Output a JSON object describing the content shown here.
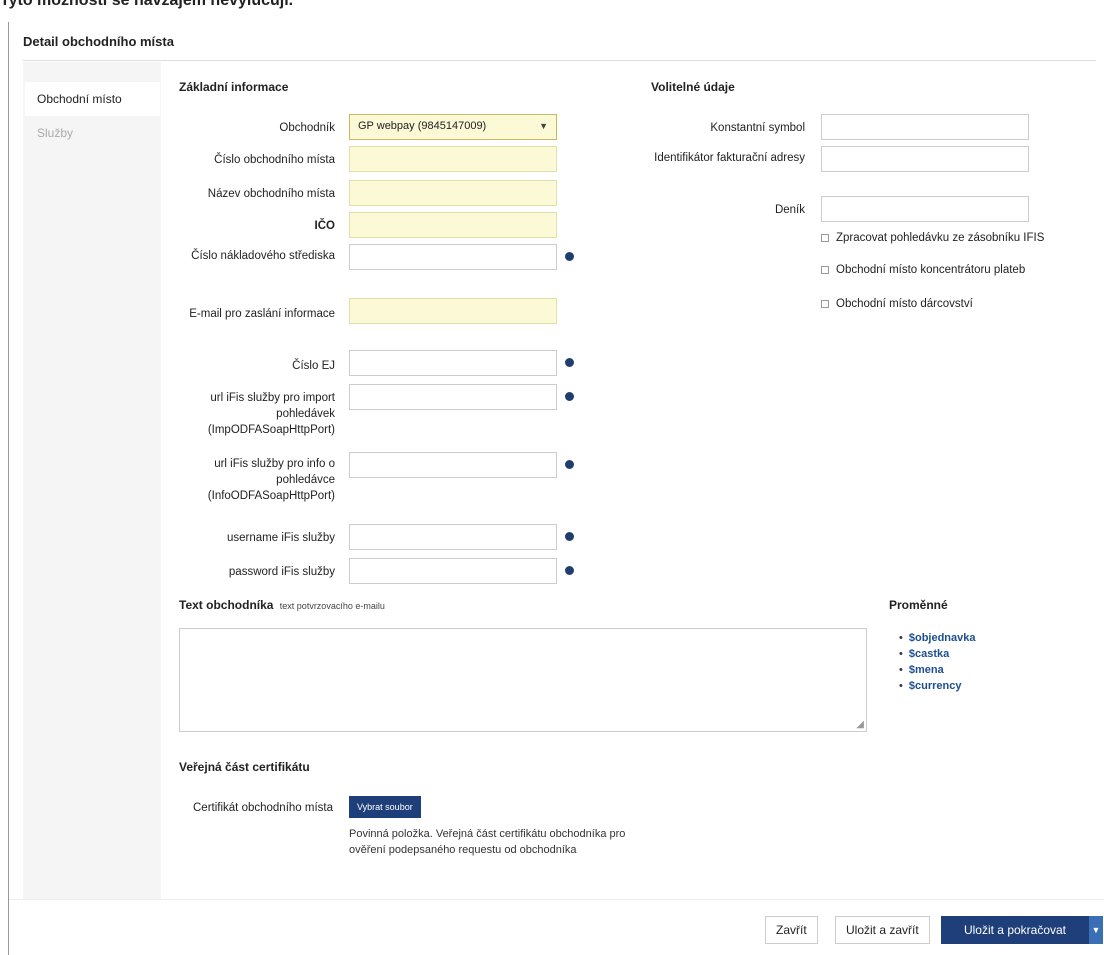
{
  "caption": "Tyto možnosti se navzájem nevylučují.",
  "dialog": {
    "title": "Detail obchodního místa"
  },
  "sidebar": {
    "items": [
      {
        "label": "Obchodní místo",
        "active": true
      },
      {
        "label": "Služby",
        "active": false
      }
    ]
  },
  "basic": {
    "title": "Základní informace",
    "merchant_label": "Obchodník",
    "merchant_value": "GP webpay (9845147009)",
    "fields": [
      {
        "label": "Číslo obchodního místa",
        "value": ""
      },
      {
        "label": "Název obchodního místa",
        "value": ""
      },
      {
        "label": "IČO",
        "value": ""
      },
      {
        "label": "Číslo nákladového střediska",
        "value": ""
      },
      {
        "label": "E-mail pro zaslání informace",
        "value": ""
      },
      {
        "label": "Číslo EJ",
        "value": ""
      },
      {
        "label": "url iFis služby pro import pohledávek (ImpODFASoapHttpPort)",
        "value": ""
      },
      {
        "label": "url iFis služby pro info o pohledávce (InfoODFASoapHttpPort)",
        "value": ""
      },
      {
        "label": "username iFis služby",
        "value": ""
      },
      {
        "label": "password iFis služby",
        "value": ""
      }
    ]
  },
  "optional": {
    "title": "Volitelné údaje",
    "fields": [
      {
        "label": "Konstantní symbol",
        "value": ""
      },
      {
        "label": "Identifikátor fakturační adresy",
        "value": ""
      },
      {
        "label": "Deník",
        "value": ""
      }
    ],
    "checkboxes": [
      "Zpracovat pohledávku ze zásobníku IFIS",
      "Obchodní místo koncentrátoru plateb",
      "Obchodní místo dárcovství"
    ]
  },
  "merchant_text": {
    "label": "Text obchodníka",
    "sublabel": "text potvrzovacího e-mailu",
    "value": ""
  },
  "variables": {
    "title": "Proměnné",
    "items": [
      "$objednavka",
      "$castka",
      "$mena",
      "$currency"
    ]
  },
  "certificate": {
    "section_title": "Veřejná část certifikátu",
    "label": "Certifikát obchodního místa",
    "button_label": "Vybrat soubor",
    "hint": "Povinná položka. Veřejná část certifikátu obchodníka pro ověření podepsaného requestu od obchodníka"
  },
  "footer": {
    "close_label": "Zavřít",
    "save_close_label": "Uložit a zavřít",
    "save_continue_label": "Uložit a pokračovat"
  },
  "colors": {
    "required_bg": "#fbf9d6",
    "primary": "#1e3f7a",
    "link": "#1c4f8f"
  }
}
